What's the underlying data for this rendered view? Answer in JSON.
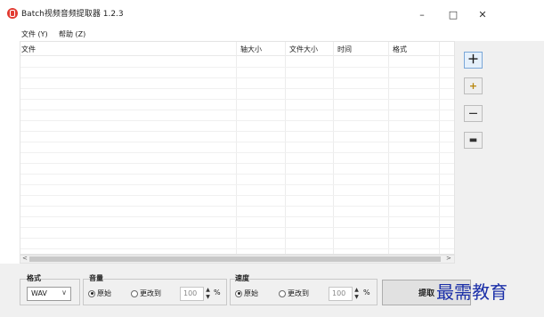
{
  "window": {
    "title": "Batch视频音频提取器 1.2.3",
    "minimize": "–",
    "maximize": "□",
    "close": "✕"
  },
  "menu": [
    "文件 (Y)",
    "帮助 (Z)"
  ],
  "table": {
    "columns": [
      "文件",
      "轴大小",
      "文件大小",
      "时间",
      "格式"
    ],
    "rows": []
  },
  "scrollbar": {
    "left_arrow": "<",
    "right_arrow": ">"
  },
  "side_buttons": [
    {
      "name": "add-file",
      "glyph": "＋"
    },
    {
      "name": "add-folder",
      "glyph": "+"
    },
    {
      "name": "remove-item",
      "glyph": "—"
    },
    {
      "name": "clear-list",
      "glyph": "▬"
    }
  ],
  "format": {
    "label": "格式",
    "selected": "WAV"
  },
  "volume": {
    "label": "音量",
    "option_original": "原始",
    "option_change": "更改到",
    "value": "100",
    "unit": "%"
  },
  "speed": {
    "label": "速度",
    "option_original": "原始",
    "option_change": "更改到",
    "value": "100",
    "unit": "%"
  },
  "extract_button": "提取",
  "watermark": "最需教育"
}
